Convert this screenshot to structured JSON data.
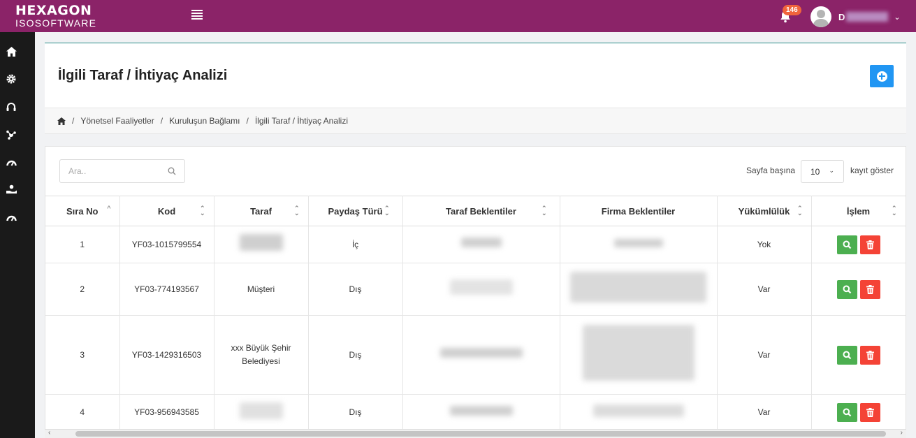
{
  "brand": {
    "line1": "HEXAGON",
    "line2": "ISOSOFTWARE"
  },
  "notifications": {
    "count": "146"
  },
  "user": {
    "initial": "D"
  },
  "sidebar": {
    "items": [
      "home-icon",
      "gear-icon",
      "headset-icon",
      "network-icon",
      "gauge-icon",
      "hand-coin-icon",
      "speedometer-icon"
    ]
  },
  "page": {
    "title": "İlgili Taraf / İhtiyaç Analizi"
  },
  "breadcrumb": [
    "Yönetsel Faaliyetler",
    "Kuruluşun Bağlamı",
    "İlgili Taraf / İhtiyaç Analizi"
  ],
  "search": {
    "placeholder": "Ara.."
  },
  "pagination": {
    "before": "Sayfa başına",
    "value": "10",
    "after": "kayıt göster"
  },
  "table": {
    "headers": [
      "Sıra No",
      "Kod",
      "Taraf",
      "Paydaş Türü",
      "Taraf Beklentiler",
      "Firma Beklentiler",
      "Yükümlülük",
      "İşlem"
    ],
    "rows": [
      {
        "no": "1",
        "kod": "YF03-1015799554",
        "taraf": "",
        "tur": "İç",
        "yukum": "Yok"
      },
      {
        "no": "2",
        "kod": "YF03-774193567",
        "taraf": "Müşteri",
        "tur": "Dış",
        "yukum": "Var"
      },
      {
        "no": "3",
        "kod": "YF03-1429316503",
        "taraf": "xxx Büyük Şehir Belediyesi",
        "tur": "Dış",
        "yukum": "Var"
      },
      {
        "no": "4",
        "kod": "YF03-956943585",
        "taraf": "",
        "tur": "Dış",
        "yukum": "Var"
      }
    ]
  },
  "colors": {
    "topbar": "#8b2368",
    "sidebar": "#1a1a1a",
    "primary": "#2196f3",
    "success": "#4caf50",
    "danger": "#f44336",
    "badge": "#f0643c"
  }
}
